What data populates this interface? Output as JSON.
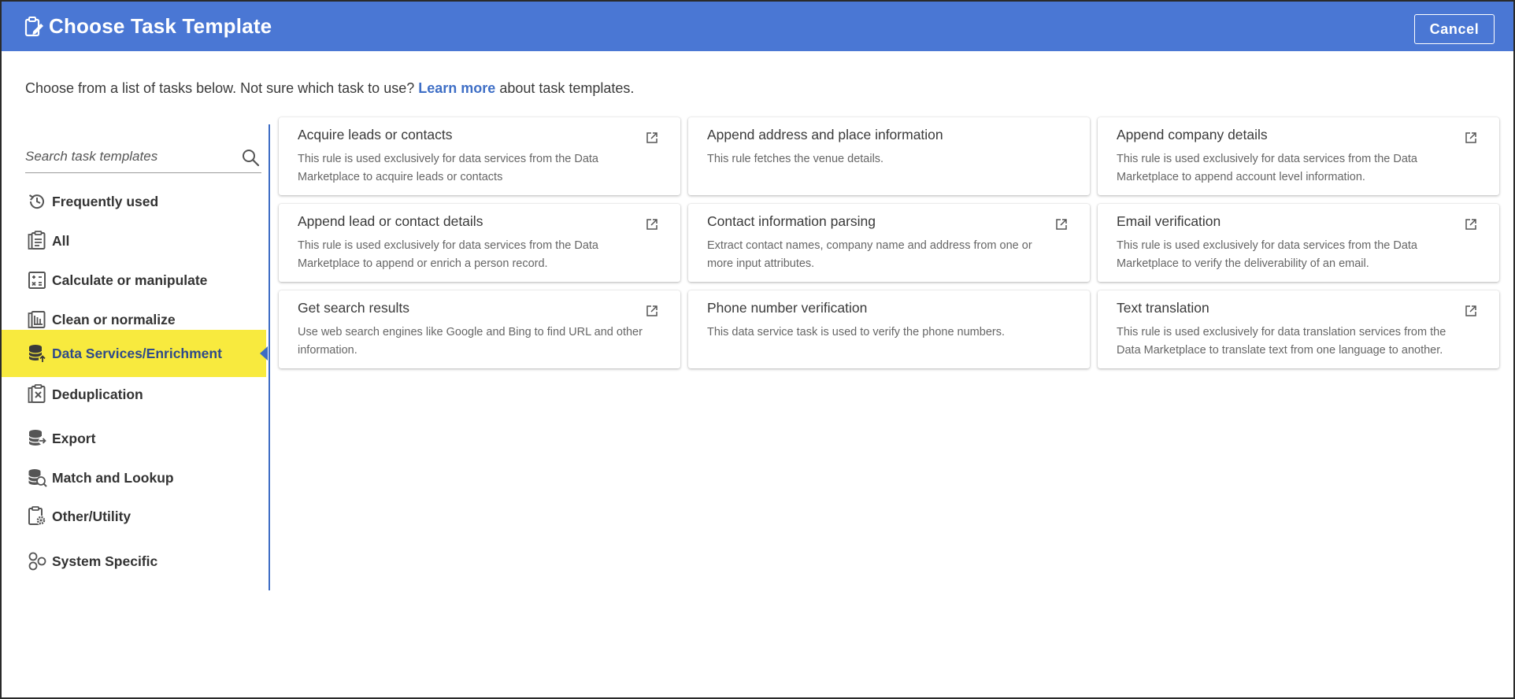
{
  "header": {
    "title": "Choose Task Template",
    "title_icon": "clipboard-edit-icon",
    "cancel_label": "Cancel"
  },
  "intro": {
    "before": "Choose from a list of tasks below. Not sure which task to use?",
    "link": "Learn more",
    "after": "about task templates."
  },
  "search": {
    "placeholder": "Search task templates"
  },
  "sidebar": {
    "items": [
      {
        "label": "Frequently used",
        "icon": "history-icon"
      },
      {
        "label": "All",
        "icon": "clipboard-list-icon"
      },
      {
        "label": "Calculate or manipulate",
        "icon": "calculator-icon"
      },
      {
        "label": "Clean or normalize",
        "icon": "clean-list-icon"
      },
      {
        "label": "Data Services/Enrichment",
        "icon": "database-enrich-icon",
        "active": true
      },
      {
        "label": "Deduplication",
        "icon": "clipboard-x-icon"
      },
      {
        "label": "Export",
        "icon": "database-export-icon"
      },
      {
        "label": "Match and Lookup",
        "icon": "database-search-icon"
      },
      {
        "label": "Other/Utility",
        "icon": "clipboard-gear-icon"
      },
      {
        "label": "System Specific",
        "icon": "shapes-icon"
      }
    ]
  },
  "cards": [
    {
      "title": "Acquire leads or contacts",
      "desc": "This rule is used exclusively for data services from the Data Marketplace to acquire leads or contacts",
      "external": true
    },
    {
      "title": "Append address and place information",
      "desc": "This rule fetches the venue details.",
      "external": false
    },
    {
      "title": "Append company details",
      "desc": "This rule is used exclusively for data services from the Data Marketplace to append account level information.",
      "external": true
    },
    {
      "title": "Append lead or contact details",
      "desc": "This rule is used exclusively for data services from the Data Marketplace to append or enrich a person record.",
      "external": true
    },
    {
      "title": "Contact information parsing",
      "desc": "Extract contact names, company name and address from one or more input attributes.",
      "external": true
    },
    {
      "title": "Email verification",
      "desc": "This rule is used exclusively for data services from the Data Marketplace to verify the deliverability of an email.",
      "external": true
    },
    {
      "title": "Get search results",
      "desc": "Use web search engines like Google and Bing to find URL and other information.",
      "external": true
    },
    {
      "title": "Phone number verification",
      "desc": "This data service task is used to verify the phone numbers.",
      "external": false
    },
    {
      "title": "Text translation",
      "desc": "This rule is used exclusively for data translation services from the Data Marketplace to translate text from one language to another.",
      "external": true
    }
  ],
  "colors": {
    "header_bg": "#4a77d4",
    "active_highlight": "#f8ea3e",
    "accent_blue": "#3d6cc4",
    "link": "#3f6fc6"
  }
}
